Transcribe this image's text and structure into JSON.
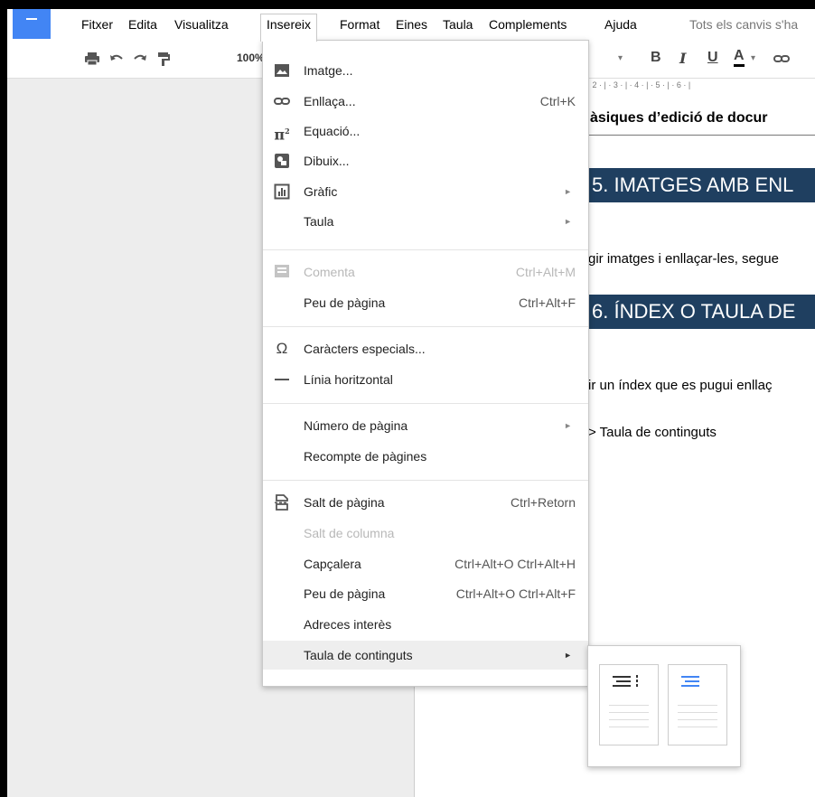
{
  "menubar": {
    "items": [
      "Fitxer",
      "Edita",
      "Visualitza",
      "Insereix",
      "Format",
      "Eines",
      "Taula",
      "Complements",
      "Ajuda"
    ],
    "active": "Insereix",
    "save_status": "Tots els canvis s'ha"
  },
  "toolbar": {
    "zoom": "100%",
    "bold": "B",
    "italic": "I",
    "underline": "U",
    "text_color": "A"
  },
  "ruler": "· 2 · | · 3 · | · 4 · | · 5 · | · 6 · |",
  "document": {
    "subtitle": "àsiques d’edició de docur",
    "heading1": "5. IMATGES AMB ENL",
    "para1": "gir imatges i enllaçar-les, segue",
    "heading2": "6. ÍNDEX O TAULA DE",
    "para2": "ir un índex que es pugui enllaç",
    "para3": "> Taula de continguts"
  },
  "insert_menu": {
    "imatge": "Imatge...",
    "enllaca": "Enllaça...",
    "enllaca_shortcut": "Ctrl+K",
    "equacio": "Equació...",
    "dibuix": "Dibuix...",
    "grafic": "Gràfic",
    "taula": "Taula",
    "comenta": "Comenta",
    "comenta_shortcut": "Ctrl+Alt+M",
    "peu1": "Peu de pàgina",
    "peu1_shortcut": "Ctrl+Alt+F",
    "caracters": "Caràcters especials...",
    "linia": "Línia horitzontal",
    "numero": "Número de pàgina",
    "recompte": "Recompte de pàgines",
    "salt_pagina": "Salt de pàgina",
    "salt_pagina_shortcut": "Ctrl+Retorn",
    "salt_columna": "Salt de columna",
    "capcalera": "Capçalera",
    "capcalera_shortcut": "Ctrl+Alt+O Ctrl+Alt+H",
    "peu2": "Peu de pàgina",
    "peu2_shortcut": "Ctrl+Alt+O Ctrl+Alt+F",
    "adreces": "Adreces interès",
    "taula_continguts": "Taula de continguts"
  },
  "icons": {
    "imatge": "image-icon",
    "enllaca": "link-icon",
    "equacio": "pi-icon",
    "dibuix": "drawing-icon",
    "grafic": "chart-icon",
    "comenta": "comment-icon",
    "caracters": "omega-icon",
    "linia": "horizontal-line-icon",
    "salt_pagina": "page-break-icon"
  },
  "colors": {
    "accent": "#4285f4",
    "heading_bg": "#1f3f60"
  }
}
